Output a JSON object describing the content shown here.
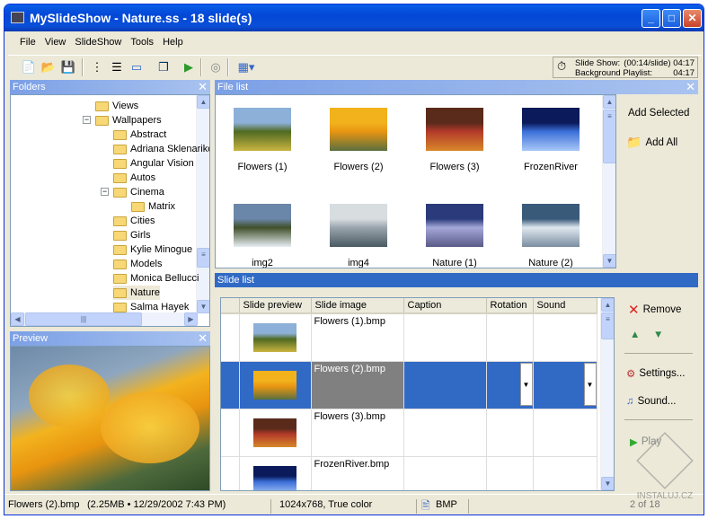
{
  "window": {
    "title": "MySlideShow - Nature.ss - 18 slide(s)"
  },
  "menu": [
    "File",
    "View",
    "SlideShow",
    "Tools",
    "Help"
  ],
  "timer": {
    "slideshow_label": "Slide Show:",
    "slideshow_value": "(00:14/slide) 04:17",
    "playlist_label": "Background Playlist:",
    "playlist_value": "04:17"
  },
  "folders": {
    "title": "Folders",
    "items": [
      {
        "label": "Views",
        "level": 0
      },
      {
        "label": "Wallpapers",
        "level": 0,
        "expanded": true
      },
      {
        "label": "Abstract",
        "level": 1
      },
      {
        "label": "Adriana Sklenarikova",
        "level": 1
      },
      {
        "label": "Angular Vision",
        "level": 1
      },
      {
        "label": "Autos",
        "level": 1
      },
      {
        "label": "Cinema",
        "level": 1,
        "expanded": true
      },
      {
        "label": "Matrix",
        "level": 2
      },
      {
        "label": "Cities",
        "level": 1
      },
      {
        "label": "Girls",
        "level": 1
      },
      {
        "label": "Kylie Minogue",
        "level": 1
      },
      {
        "label": "Models",
        "level": 1
      },
      {
        "label": "Monica Bellucci",
        "level": 1
      },
      {
        "label": "Nature",
        "level": 1,
        "selected": true
      },
      {
        "label": "Salma Hayek",
        "level": 1
      }
    ]
  },
  "preview": {
    "title": "Preview"
  },
  "filelist": {
    "title": "File list",
    "files": [
      {
        "name": "Flowers (1)",
        "colors": [
          "#8db0d8",
          "#4f6a22",
          "#c9b440"
        ]
      },
      {
        "name": "Flowers (2)",
        "colors": [
          "#f2b21c",
          "#e89512",
          "#5a7040"
        ]
      },
      {
        "name": "Flowers (3)",
        "colors": [
          "#5a2a1a",
          "#b33a2a",
          "#d8882a"
        ]
      },
      {
        "name": "FrozenRiver",
        "colors": [
          "#0a1a5a",
          "#3b6fd8",
          "#a9c8f8"
        ]
      },
      {
        "name": "img2",
        "colors": [
          "#6a86a8",
          "#40502a",
          "#e8eef4"
        ]
      },
      {
        "name": "img4",
        "colors": [
          "#d8dde0",
          "#9aa5ad",
          "#4a5a62"
        ]
      },
      {
        "name": "Nature (1)",
        "colors": [
          "#2a3a7a",
          "#a4a8d8",
          "#5a5a88"
        ]
      },
      {
        "name": "Nature (2)",
        "colors": [
          "#3a5a7a",
          "#dfe8ef",
          "#7a8ea0"
        ]
      }
    ],
    "add_selected": "Add Selected",
    "add_all": "Add All"
  },
  "slidelist": {
    "title": "Slide list",
    "columns": [
      "Slide preview",
      "Slide image",
      "Caption",
      "Rotation",
      "Sound"
    ],
    "rows": [
      {
        "image": "Flowers (1).bmp",
        "colors": [
          "#8db0d8",
          "#4f6a22",
          "#c9b440"
        ]
      },
      {
        "image": "Flowers (2).bmp",
        "colors": [
          "#f2b21c",
          "#e89512",
          "#5a7040"
        ],
        "selected": true
      },
      {
        "image": "Flowers (3).bmp",
        "colors": [
          "#5a2a1a",
          "#b33a2a",
          "#d8882a"
        ]
      },
      {
        "image": "FrozenRiver.bmp",
        "colors": [
          "#0a1a5a",
          "#3b6fd8",
          "#a9c8f8"
        ]
      }
    ],
    "remove": "Remove",
    "settings": "Settings...",
    "sound": "Sound...",
    "play": "Play"
  },
  "status": {
    "file": "Flowers (2).bmp",
    "info": "(2.25MB • 12/29/2002 7:43 PM)",
    "dims": "1024x768, True color",
    "format": "BMP",
    "position": "2 of 18"
  },
  "watermark": "INSTALUJ.CZ"
}
